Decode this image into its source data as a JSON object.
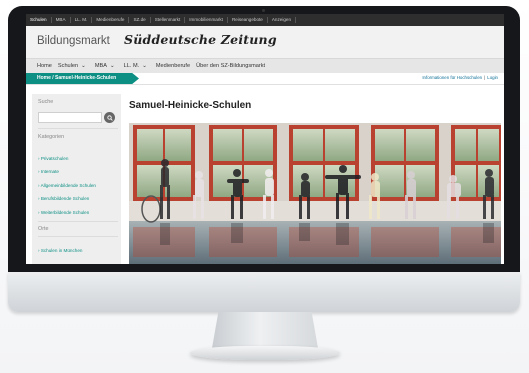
{
  "topbar": {
    "items": [
      "Schulen",
      "MBA",
      "LL. M.",
      "Medienberufe",
      "SZ.de",
      "Stellenmarkt",
      "Immobilienmarkt",
      "Reiseangebote",
      "Anzeigen"
    ]
  },
  "header": {
    "brand": "Bildungsmarkt",
    "logo": "Süddeutsche Zeitung"
  },
  "nav": {
    "items": [
      {
        "label": "Home",
        "dropdown": false
      },
      {
        "label": "Schulen",
        "dropdown": true
      },
      {
        "label": "MBA",
        "dropdown": true
      },
      {
        "label": "LL. M.",
        "dropdown": true
      },
      {
        "label": "Medienberufe",
        "dropdown": false
      },
      {
        "label": "Über den SZ-Bildungsmarkt",
        "dropdown": false
      }
    ]
  },
  "breadcrumb": {
    "text": "Home / Samuel-Heinicke-Schulen",
    "links": [
      "Informationen für Hochschulen",
      "Login"
    ],
    "separator": "|"
  },
  "sidebar": {
    "search_label": "Suche",
    "search_placeholder": "",
    "categories_label": "Kategorien",
    "categories": [
      "Privatschulen",
      "Internate",
      "Allgemeinbildende Schulen",
      "Berufsbildende Schulen",
      "Weiterbildende Schulen"
    ],
    "orte_label": "Orte",
    "orte": [
      "Schulen in München"
    ]
  },
  "main": {
    "title": "Samuel-Heinicke-Schulen"
  },
  "colors": {
    "accent": "#0d8f84",
    "topbar": "#2e2e2e",
    "link": "#0d6f96"
  },
  "icons": {
    "search": "search-icon"
  }
}
